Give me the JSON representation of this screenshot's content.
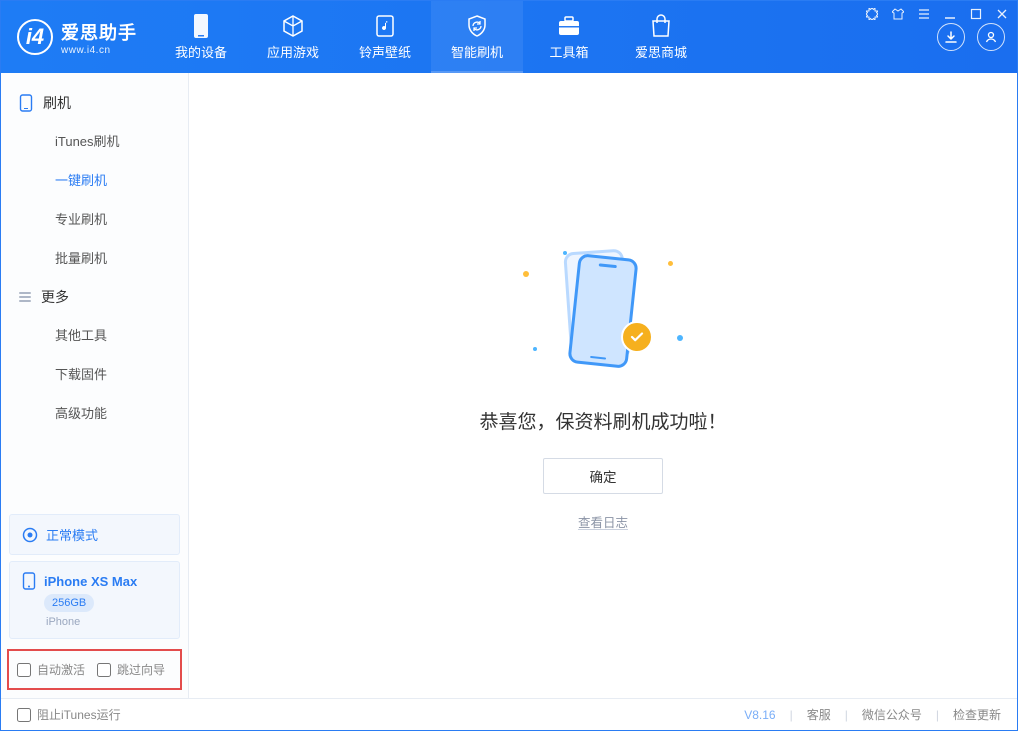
{
  "app": {
    "name": "爱思助手",
    "url": "www.i4.cn"
  },
  "nav": {
    "items": [
      {
        "label": "我的设备"
      },
      {
        "label": "应用游戏"
      },
      {
        "label": "铃声壁纸"
      },
      {
        "label": "智能刷机"
      },
      {
        "label": "工具箱"
      },
      {
        "label": "爱思商城"
      }
    ]
  },
  "sidebar": {
    "section1": {
      "title": "刷机",
      "items": [
        "iTunes刷机",
        "一键刷机",
        "专业刷机",
        "批量刷机"
      ]
    },
    "section2": {
      "title": "更多",
      "items": [
        "其他工具",
        "下载固件",
        "高级功能"
      ]
    },
    "mode_label": "正常模式",
    "device": {
      "name": "iPhone XS Max",
      "capacity": "256GB",
      "type": "iPhone"
    },
    "footer": {
      "auto_activate": "自动激活",
      "skip_guide": "跳过向导"
    }
  },
  "main": {
    "success_title": "恭喜您，保资料刷机成功啦！",
    "ok_label": "确定",
    "log_link": "查看日志"
  },
  "status": {
    "block_itunes": "阻止iTunes运行",
    "version": "V8.16",
    "links": [
      "客服",
      "微信公众号",
      "检查更新"
    ]
  }
}
